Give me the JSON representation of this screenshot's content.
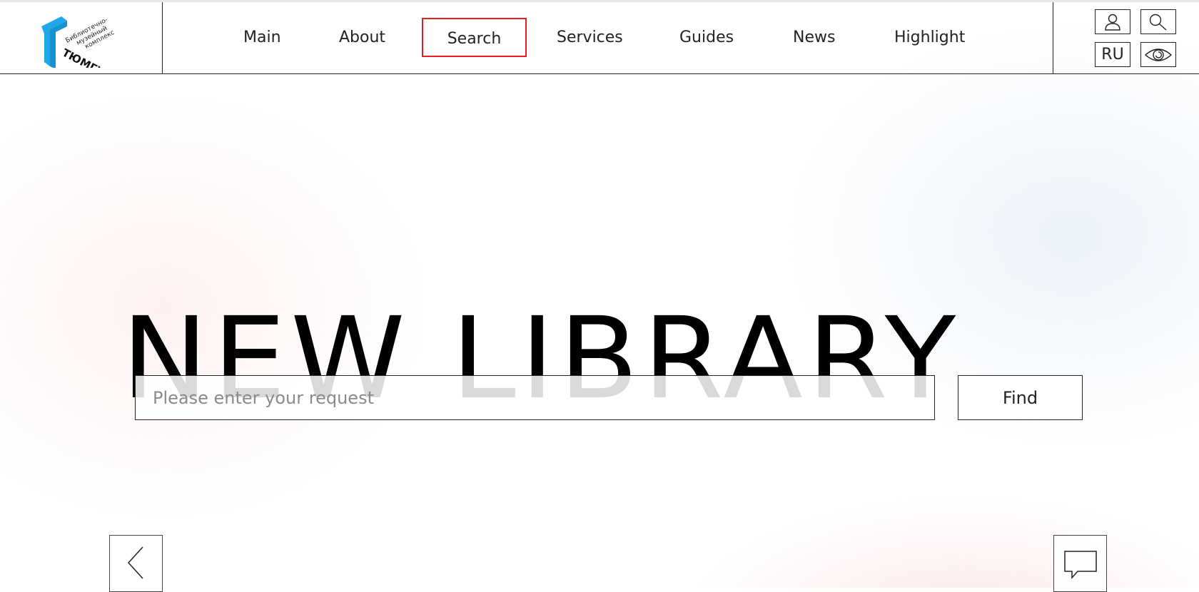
{
  "header": {
    "logo": {
      "brand": "ТЮМГУ",
      "caption_lines": [
        "Библиотечно-",
        "музейный",
        "комплекс"
      ],
      "accent_color": "#1fa7e8"
    },
    "nav": {
      "items": [
        {
          "label": "Main",
          "active": false
        },
        {
          "label": "About",
          "active": false
        },
        {
          "label": "Search",
          "active": true
        },
        {
          "label": "Services",
          "active": false
        },
        {
          "label": "Guides",
          "active": false
        },
        {
          "label": "News",
          "active": false
        },
        {
          "label": "Highlight",
          "active": false
        }
      ],
      "active_color": "#e31e24"
    },
    "tools": {
      "account_icon": "user-icon",
      "search_icon": "search-icon",
      "language_label": "RU",
      "accessibility_icon": "eye-icon"
    }
  },
  "hero": {
    "title": "NEW LIBRARY",
    "search": {
      "value": "",
      "placeholder": "Please enter your request",
      "button_label": "Find"
    }
  },
  "footer_controls": {
    "prev_icon": "chevron-left-icon",
    "chat_icon": "chat-bubble-icon"
  }
}
